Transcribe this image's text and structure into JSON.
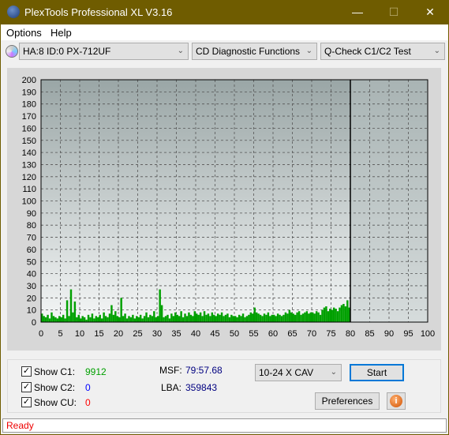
{
  "window": {
    "title": "PlexTools Professional XL V3.16",
    "logo_text": "XL",
    "minimize": "—",
    "maximize": "☐",
    "close": "✕"
  },
  "menu": [
    {
      "label": "Options"
    },
    {
      "label": "Help"
    }
  ],
  "toolbar": {
    "drive": "HA:8 ID:0  PX-712UF",
    "function": "CD Diagnostic Functions",
    "test": "Q-Check C1/C2 Test",
    "drive_icon": "cd-drive-icon"
  },
  "chart_data": {
    "type": "bar",
    "xlim": [
      0,
      100
    ],
    "ylim": [
      0,
      200
    ],
    "xticks": [
      0,
      5,
      10,
      15,
      20,
      25,
      30,
      35,
      40,
      45,
      50,
      55,
      60,
      65,
      70,
      75,
      80,
      85,
      90,
      95,
      100
    ],
    "yticks": [
      0,
      10,
      20,
      30,
      40,
      50,
      60,
      70,
      80,
      90,
      100,
      110,
      120,
      130,
      140,
      150,
      160,
      170,
      180,
      190,
      200
    ],
    "grid": true,
    "disc_end": 80,
    "step": 0.5,
    "series": [
      {
        "color": "#00a000",
        "x_start": 0,
        "values": [
          7,
          5,
          4,
          6,
          3,
          8,
          5,
          4,
          3,
          5,
          4,
          6,
          3,
          18,
          5,
          27,
          8,
          17,
          4,
          6,
          3,
          5,
          4,
          2,
          6,
          4,
          7,
          3,
          5,
          4,
          6,
          3,
          8,
          5,
          4,
          7,
          14,
          6,
          9,
          5,
          4,
          20,
          5,
          7,
          3,
          5,
          4,
          6,
          3,
          5,
          4,
          6,
          3,
          5,
          8,
          4,
          6,
          5,
          9,
          4,
          5,
          27,
          14,
          4,
          5,
          6,
          3,
          7,
          5,
          8,
          6,
          5,
          9,
          4,
          7,
          5,
          8,
          6,
          5,
          9,
          7,
          6,
          8,
          5,
          9,
          6,
          7,
          5,
          8,
          6,
          5,
          7,
          6,
          8,
          5,
          6,
          7,
          4,
          6,
          5,
          5,
          4,
          6,
          5,
          7,
          4,
          5,
          6,
          8,
          7,
          12,
          8,
          7,
          6,
          5,
          7,
          6,
          8,
          5,
          6,
          6,
          5,
          7,
          6,
          5,
          6,
          8,
          7,
          10,
          8,
          7,
          6,
          8,
          9,
          6,
          7,
          8,
          9,
          7,
          8,
          8,
          7,
          9,
          8,
          6,
          10,
          12,
          13,
          9,
          11,
          10,
          12,
          11,
          9,
          12,
          14,
          15,
          13,
          18,
          12
        ]
      }
    ]
  },
  "stats": {
    "show_c1": "Show C1:",
    "c1": "9912",
    "c1_color": "#00a000",
    "show_c2": "Show C2:",
    "c2": "0",
    "c2_color": "#0000ff",
    "show_cu": "Show CU:",
    "cu": "0",
    "cu_color": "#ff0000",
    "msf_label": "MSF:",
    "msf": "79:57.68",
    "lba_label": "LBA:",
    "lba": "359843"
  },
  "controls": {
    "speed": "10-24 X CAV",
    "start": "Start",
    "preferences": "Preferences",
    "info_icon": "info-icon"
  },
  "status": "Ready"
}
